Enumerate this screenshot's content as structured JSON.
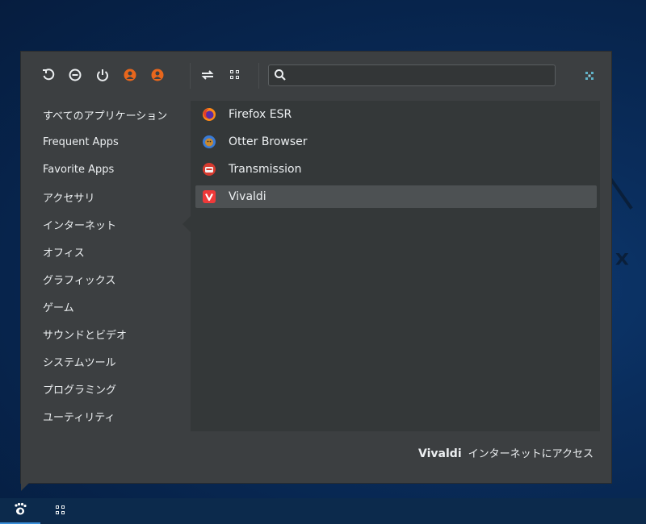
{
  "toolbar": {
    "buttons": [
      {
        "name": "refresh-icon"
      },
      {
        "name": "lock-icon"
      },
      {
        "name": "power-icon"
      },
      {
        "name": "user-icon"
      },
      {
        "name": "user-switch-icon"
      },
      {
        "name": "swap-view-icon"
      },
      {
        "name": "grid-view-icon"
      },
      {
        "name": "settings-icon"
      }
    ],
    "user_color": "#e8661c"
  },
  "search": {
    "value": "",
    "placeholder": ""
  },
  "categories": [
    {
      "label": "すべてのアプリケーション"
    },
    {
      "label": "Frequent Apps"
    },
    {
      "label": "Favorite Apps"
    },
    {
      "label": "アクセサリ"
    },
    {
      "label": "インターネット"
    },
    {
      "label": "オフィス"
    },
    {
      "label": "グラフィックス"
    },
    {
      "label": "ゲーム"
    },
    {
      "label": "サウンドとビデオ"
    },
    {
      "label": "システムツール"
    },
    {
      "label": "プログラミング"
    },
    {
      "label": "ユーティリティ"
    }
  ],
  "selected_category": "インターネット",
  "apps": [
    {
      "label": "Firefox ESR",
      "icon": "firefox-icon"
    },
    {
      "label": "Otter Browser",
      "icon": "otter-browser-icon"
    },
    {
      "label": "Transmission",
      "icon": "transmission-icon"
    },
    {
      "label": "Vivaldi",
      "icon": "vivaldi-icon",
      "selected": true
    }
  ],
  "footer": {
    "app_name": "Vivaldi",
    "description": "インターネットにアクセス"
  },
  "taskbar": {
    "apps_button_icon": "gnome-foot-icon",
    "grid_button_icon": "app-grid-icon"
  },
  "colors": {
    "menu_bg": "#3c3f41",
    "panel_bg": "#343839",
    "selected_bg": "#4d5153",
    "taskbar_bg": "#0c2a4c",
    "accent": "#3b8fd9"
  }
}
